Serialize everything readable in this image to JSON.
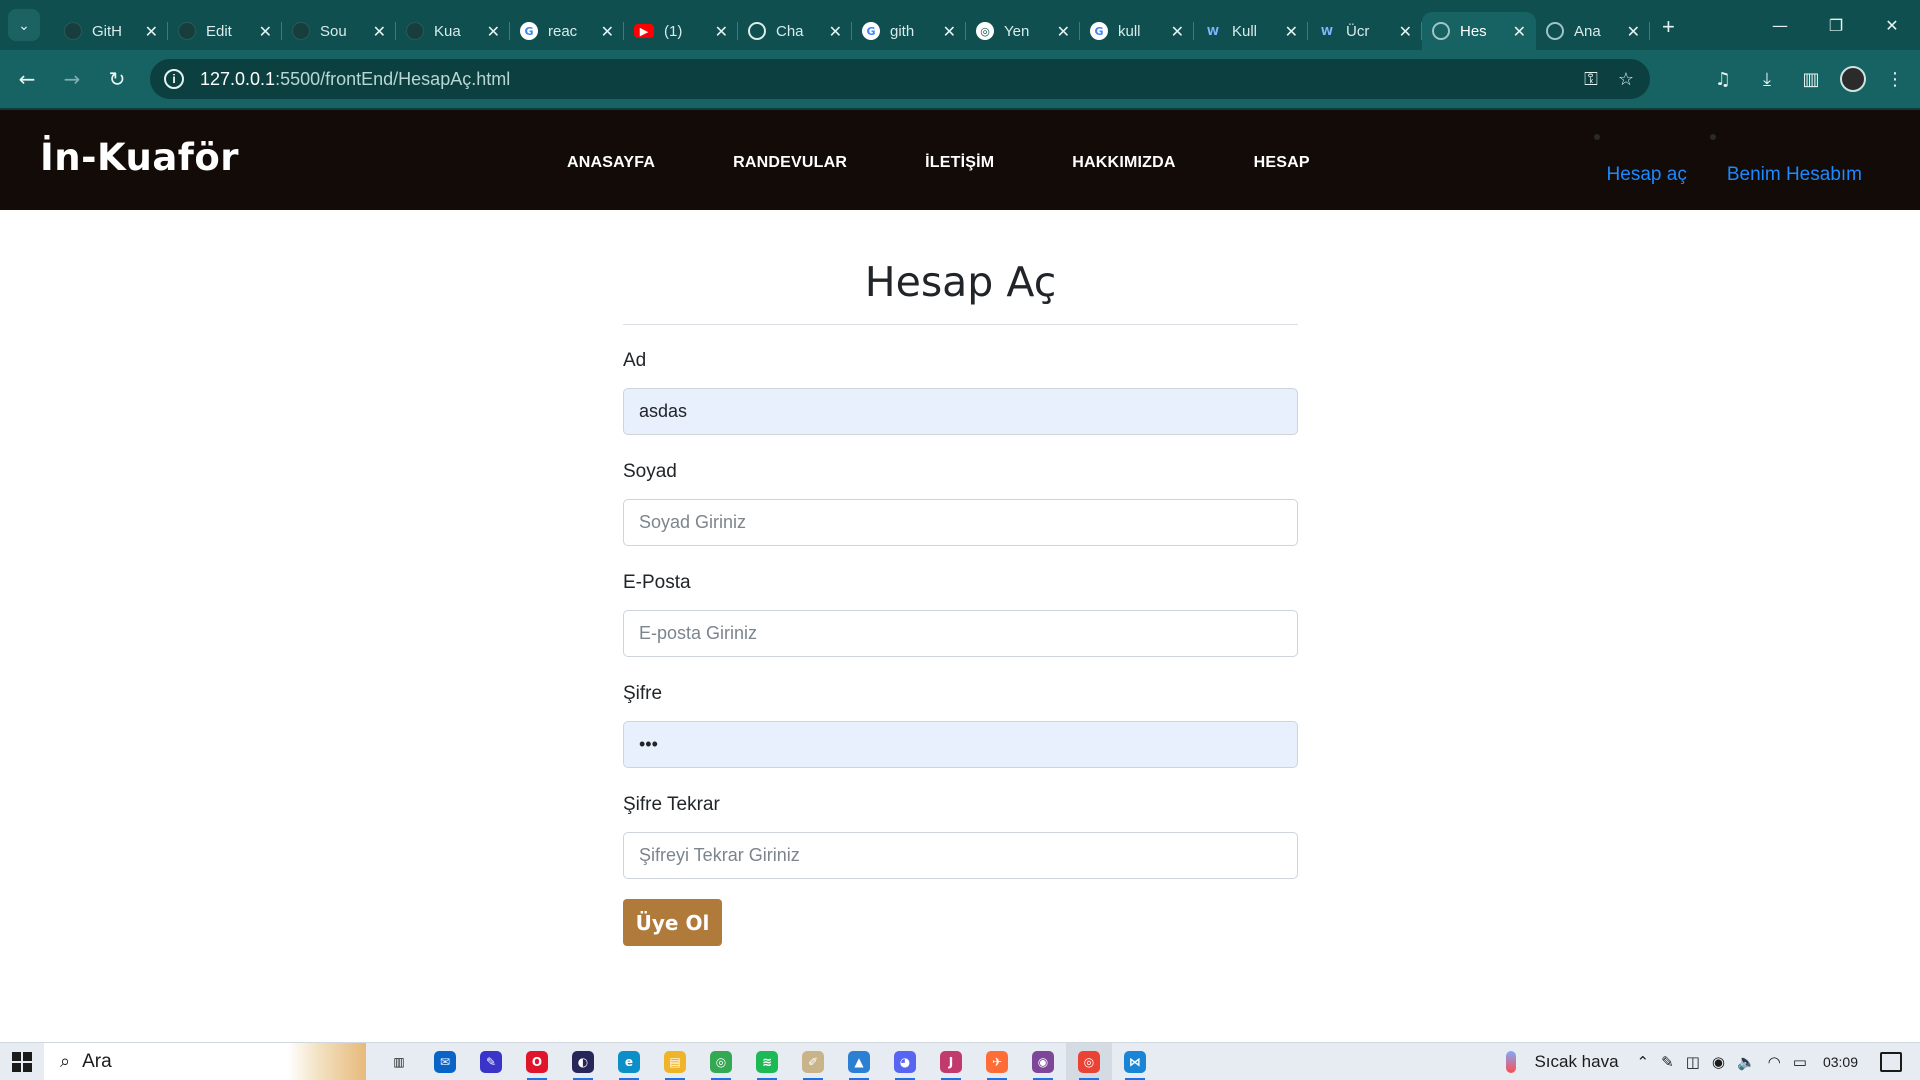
{
  "browser": {
    "tabs": [
      {
        "title": "GitH",
        "favicon": "github-icon",
        "active": false
      },
      {
        "title": "Edit",
        "favicon": "github-icon",
        "active": false
      },
      {
        "title": "Sou",
        "favicon": "github-icon",
        "active": false
      },
      {
        "title": "Kua",
        "favicon": "github-icon",
        "active": false
      },
      {
        "title": "reac",
        "favicon": "google-icon",
        "active": false
      },
      {
        "title": "(1) ",
        "favicon": "youtube-icon",
        "active": false
      },
      {
        "title": "Cha",
        "favicon": "chatgpt-icon",
        "active": false
      },
      {
        "title": "gith",
        "favicon": "google-icon",
        "active": false
      },
      {
        "title": "Yen",
        "favicon": "chrome-icon",
        "active": false
      },
      {
        "title": "kull",
        "favicon": "google-icon",
        "active": false
      },
      {
        "title": "Kull",
        "favicon": "kul-icon",
        "active": false
      },
      {
        "title": "Ücr",
        "favicon": "kul-icon",
        "active": false
      },
      {
        "title": "Hes",
        "favicon": "globe-icon",
        "active": true
      },
      {
        "title": "Ana",
        "favicon": "globe-icon",
        "active": false
      }
    ],
    "url_host": "127.0.0.1",
    "url_path": ":5500/frontEnd/HesapAç.html"
  },
  "site": {
    "brand": "İn-Kuaför",
    "menu": [
      "ANASAYFA",
      "RANDEVULAR",
      "İLETİŞİM",
      "HAKKIMIZDA",
      "HESAP"
    ],
    "account_links": {
      "signup": "Hesap aç",
      "my_account": "Benim Hesabım"
    },
    "link_color": "#1e88ff"
  },
  "form": {
    "title": "Hesap Aç",
    "fields": [
      {
        "label": "Ad",
        "value": "asdas",
        "placeholder": "",
        "type": "text"
      },
      {
        "label": "Soyad",
        "value": "",
        "placeholder": "Soyad Giriniz",
        "type": "text"
      },
      {
        "label": "E-Posta",
        "value": "",
        "placeholder": "E-posta Giriniz",
        "type": "email"
      },
      {
        "label": "Şifre",
        "value": "•••",
        "placeholder": "",
        "type": "password"
      },
      {
        "label": "Şifre Tekrar",
        "value": "",
        "placeholder": "Şifreyi Tekrar Giriniz",
        "type": "password"
      }
    ],
    "submit_label": "Üye Ol",
    "submit_color": "#b07a3a"
  },
  "taskbar": {
    "search_placeholder": "Ara",
    "weather_text": "Sıcak hava",
    "clock": "03:09",
    "apps": [
      "task-view",
      "mail",
      "notes",
      "opera",
      "app-dark",
      "edge",
      "file-explorer",
      "chrome",
      "spotify",
      "paint",
      "photos",
      "discord",
      "jetbrains",
      "postman",
      "tor",
      "chrome-active",
      "vscode"
    ]
  }
}
